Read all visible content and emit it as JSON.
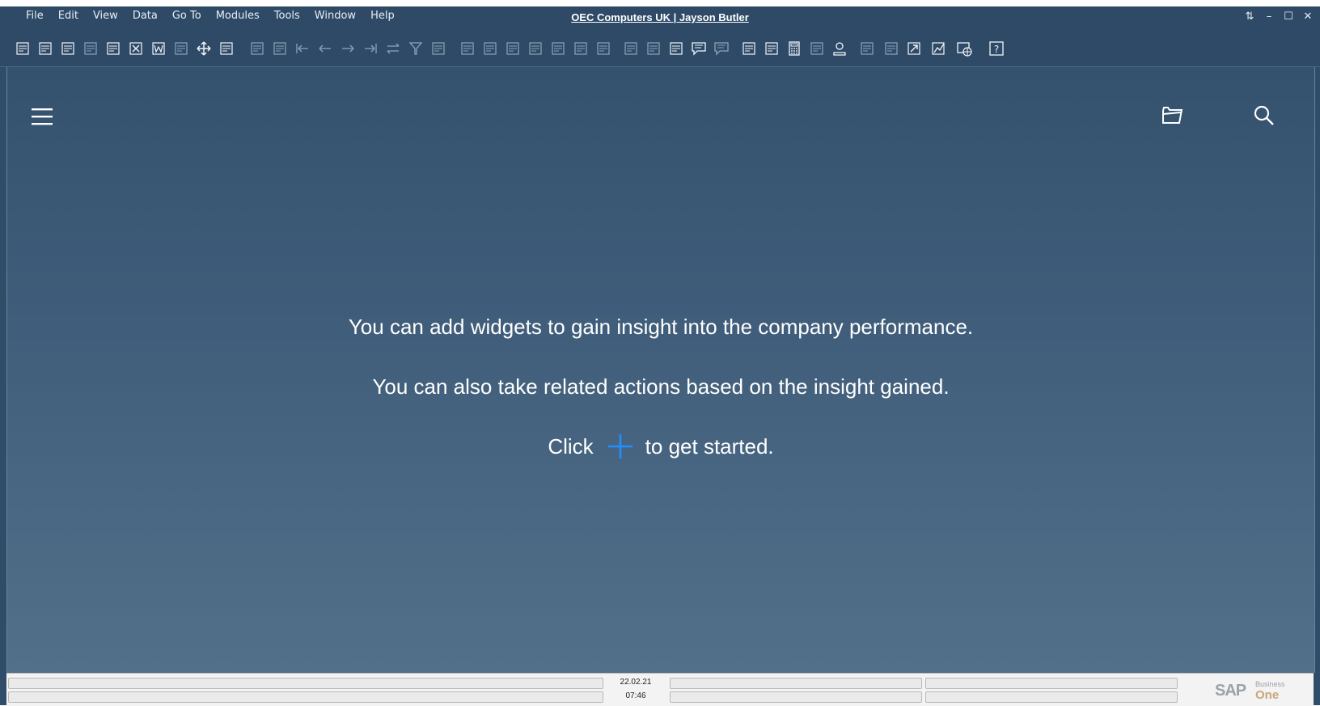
{
  "menu": {
    "items": [
      {
        "label": "File"
      },
      {
        "label": "Edit"
      },
      {
        "label": "View"
      },
      {
        "label": "Data"
      },
      {
        "label": "Go To"
      },
      {
        "label": "Modules"
      },
      {
        "label": "Tools"
      },
      {
        "label": "Window"
      },
      {
        "label": "Help"
      }
    ]
  },
  "window": {
    "title": "OEC Computers UK | Jayson Butler"
  },
  "toolbar": {
    "icons": [
      "preview-icon",
      "print-icon",
      "print-layout-icon",
      "send-email-icon",
      "fax-icon",
      "export-excel-icon",
      "export-word-icon",
      "export-pdf-icon",
      "move-icon",
      "lock-form-icon",
      "find-icon",
      "add-icon",
      "first-record-icon",
      "previous-record-icon",
      "next-record-icon",
      "last-record-icon",
      "refresh-icon",
      "filter-icon",
      "sort-icon",
      "base-document-icon",
      "target-document-icon",
      "payment-icon",
      "payment-means-icon",
      "balance-icon",
      "journal-icon",
      "transactions-icon",
      "edit-icon",
      "form-settings-icon",
      "document-settings-icon",
      "message-icon",
      "alert-icon",
      "calendar-icon",
      "reports-icon",
      "calculator-icon",
      "connect-icon",
      "user-icon",
      "add-on-icon",
      "layout-icon",
      "drilldown-icon",
      "analytics-icon",
      "web-icon",
      "help-icon"
    ]
  },
  "main": {
    "line1": "You can add widgets to gain insight into the company performance.",
    "line2": "You can also take related actions based on the insight gained.",
    "line3_pre": "Click",
    "line3_post": "to get started."
  },
  "status": {
    "date": "22.02.21",
    "time": "07:46"
  },
  "logo": {
    "brand": "SAP",
    "sub": "Business",
    "one": "One"
  },
  "colors": {
    "accent_plus": "#1e90ff",
    "menubar_bg": "#2e4a67"
  }
}
